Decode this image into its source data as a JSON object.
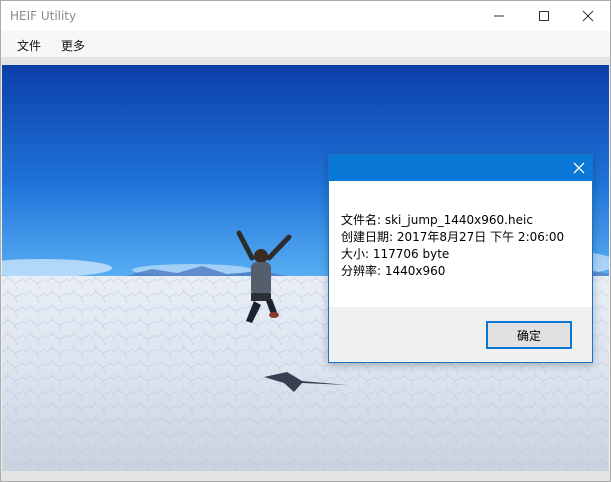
{
  "window": {
    "title": "HEIF Utility",
    "controls": [
      "minimize",
      "maximize",
      "close"
    ]
  },
  "menu": {
    "items": [
      {
        "label": "文件"
      },
      {
        "label": "更多"
      }
    ]
  },
  "viewer": {
    "image_description_icon": "photo-image"
  },
  "dialog": {
    "lines": [
      "文件名: ski_jump_1440x960.heic",
      "创建日期: 2017年8月27日 下午 2:06:00",
      "大小: 117706 byte",
      "分辨率: 1440x960"
    ],
    "ok_label": "确定"
  },
  "colors": {
    "accent": "#0a78d7",
    "sky_top": "#0b3fa8",
    "sky_bottom": "#3f9df0",
    "salt_flat": "#dfe7f1"
  }
}
